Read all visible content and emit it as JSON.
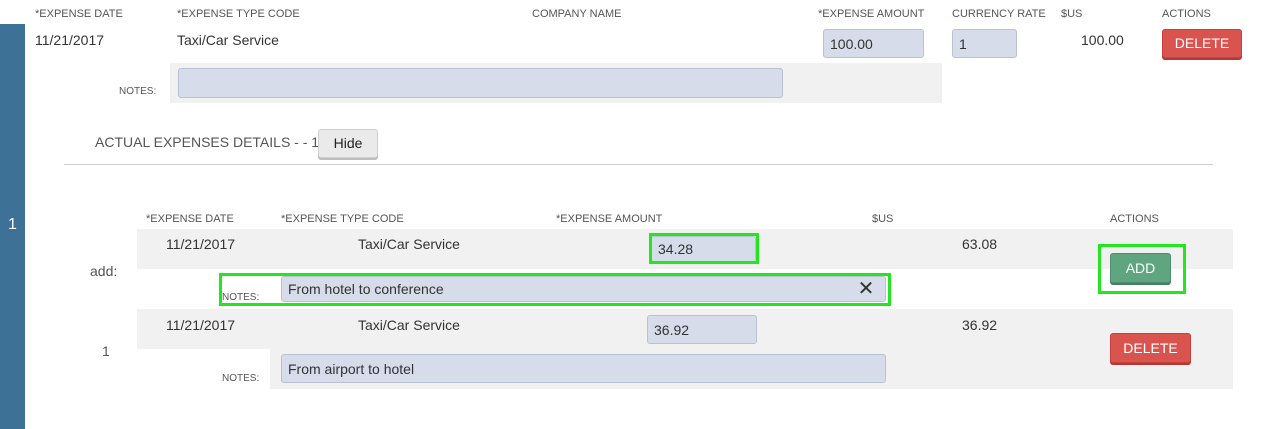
{
  "row_number": "1",
  "expense": {
    "headers": {
      "date": "*EXPENSE DATE",
      "type": "*EXPENSE TYPE CODE",
      "company": "COMPANY NAME",
      "amount": "*EXPENSE AMOUNT",
      "rate": "CURRENCY RATE",
      "usd": "$US",
      "actions": "ACTIONS"
    },
    "date": "11/21/2017",
    "type": "Taxi/Car Service",
    "amount": "100.00",
    "rate": "1",
    "usd": "100.00",
    "delete_label": "DELETE",
    "notes_label": "NOTES:",
    "notes_value": ""
  },
  "details": {
    "title": "ACTUAL EXPENSES DETAILS - - 1",
    "hide_label": "Hide",
    "headers": {
      "date": "*EXPENSE DATE",
      "type": "*EXPENSE TYPE CODE",
      "amount": "*EXPENSE AMOUNT",
      "usd": "$US",
      "actions": "ACTIONS"
    },
    "add_row": {
      "label": "add:",
      "date": "11/21/2017",
      "type": "Taxi/Car Service",
      "amount": "34.28",
      "usd": "63.08",
      "notes_label": "NOTES:",
      "notes": "From hotel to conference",
      "add_label": "ADD",
      "clear_icon": "close-icon"
    },
    "rows": [
      {
        "index": "1",
        "date": "11/21/2017",
        "type": "Taxi/Car Service",
        "amount": "36.92",
        "usd": "36.92",
        "notes_label": "NOTES:",
        "notes": "From airport to hotel",
        "delete_label": "DELETE"
      }
    ]
  }
}
